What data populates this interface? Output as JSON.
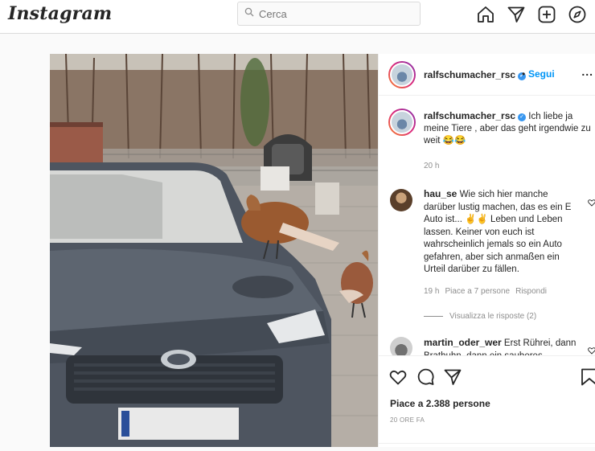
{
  "app": {
    "logo": "Instagram"
  },
  "search": {
    "placeholder": "Cerca"
  },
  "nav": {
    "icons": [
      "home-icon",
      "direct-icon",
      "new-post-icon",
      "explore-icon"
    ]
  },
  "post": {
    "username": "ralfschumacher_rsc",
    "follow_label": "Segui",
    "separator": "•",
    "more_label": "...",
    "caption": "Ich liebe ja meine Tiere , aber das geht irgendwie zu weit 😂😂",
    "caption_time": "20 h",
    "comments": [
      {
        "username": "hau_se",
        "text": "Wie sich hier manche darüber lustig machen, das es ein E Auto ist... ✌️✌️ Leben und Leben lassen. Keiner von euch ist wahrscheinlich jemals so ein Auto gefahren, aber sich anmaßen ein Urteil darüber zu fällen.",
        "time": "19 h",
        "likes": "Piace a 7 persone",
        "reply": "Rispondi",
        "view_replies": "Visualizza le risposte (2)"
      },
      {
        "username": "martin_oder_wer",
        "text": "Erst Rührei, dann Brathuhn, dann ein sauberes"
      }
    ],
    "likes": "Piace a 2.388 persone",
    "posted": "20 ORE FA"
  },
  "colors": {
    "accent": "#0095f6",
    "verified": "#3897f0",
    "border": "#dbdbdb",
    "muted": "#8e8e8e"
  }
}
